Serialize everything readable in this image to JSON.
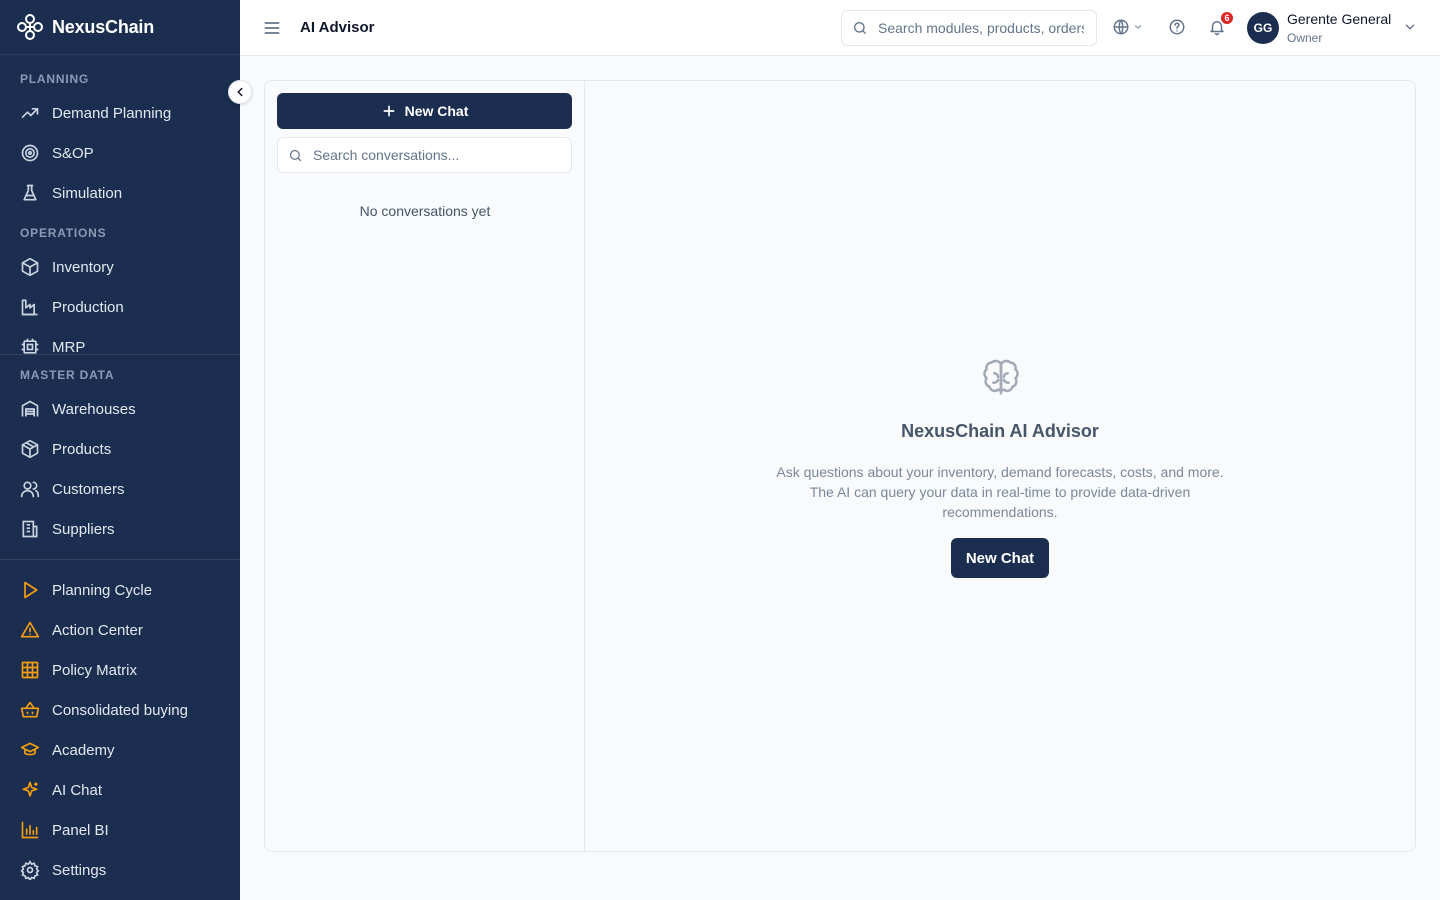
{
  "app": {
    "name": "NexusChain"
  },
  "header": {
    "title": "AI Advisor",
    "search_placeholder": "Search modules, products, orders...",
    "notification_count": "6",
    "user": {
      "initials": "GG",
      "name": "Gerente General",
      "role": "Owner"
    }
  },
  "sidebar": {
    "planning_label": "PLANNING",
    "planning": [
      {
        "label": "Demand Planning",
        "icon": "trending-up-icon"
      },
      {
        "label": "S&OP",
        "icon": "target-icon"
      },
      {
        "label": "Simulation",
        "icon": "flask-icon"
      }
    ],
    "operations_label": "OPERATIONS",
    "operations": [
      {
        "label": "Inventory",
        "icon": "package-icon"
      },
      {
        "label": "Production",
        "icon": "factory-icon"
      },
      {
        "label": "MRP",
        "icon": "cpu-icon"
      }
    ],
    "master_label": "MASTER DATA",
    "master": [
      {
        "label": "Warehouses",
        "icon": "warehouse-icon"
      },
      {
        "label": "Products",
        "icon": "products-icon"
      },
      {
        "label": "Customers",
        "icon": "users-icon"
      },
      {
        "label": "Suppliers",
        "icon": "building-icon"
      }
    ],
    "bottom": [
      {
        "label": "Planning Cycle",
        "icon": "play-icon"
      },
      {
        "label": "Action Center",
        "icon": "alert-triangle-icon"
      },
      {
        "label": "Policy Matrix",
        "icon": "grid-icon"
      },
      {
        "label": "Consolidated buying",
        "icon": "basket-icon"
      },
      {
        "label": "Academy",
        "icon": "graduation-cap-icon"
      },
      {
        "label": "AI Chat",
        "icon": "sparkles-icon"
      },
      {
        "label": "Panel BI",
        "icon": "bar-chart-icon"
      },
      {
        "label": "Settings",
        "icon": "gear-icon"
      }
    ]
  },
  "colors": {
    "sidebar": "#1b2e4f",
    "accent_icon": "#f59e0b",
    "primary": "#1b2e4f",
    "badge": "#dc2626"
  },
  "conversations": {
    "new_chat_label": "New Chat",
    "search_placeholder": "Search conversations...",
    "empty_text": "No conversations yet"
  },
  "empty_state": {
    "title": "NexusChain AI Advisor",
    "description": "Ask questions about your inventory, demand forecasts, costs, and more. The AI can query your data in real-time to provide data-driven recommendations.",
    "button_label": "New Chat"
  }
}
